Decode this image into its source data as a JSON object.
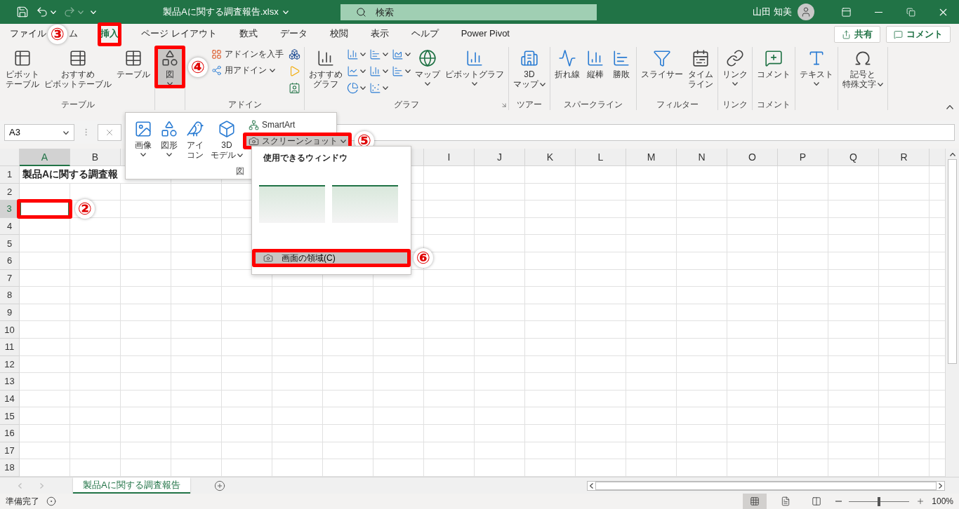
{
  "title_bar": {
    "file_name": "製品Aに関する調査報告.xlsx",
    "search_placeholder": "検索",
    "user_name": "山田 知美"
  },
  "tabs": [
    {
      "label": "ファイル",
      "selected": false
    },
    {
      "label": "ム",
      "selected": false
    },
    {
      "label": "挿入",
      "selected": true,
      "annotation": {
        "number": "③",
        "kind": "left"
      }
    },
    {
      "label": "ページ レイアウト",
      "selected": false
    },
    {
      "label": "数式",
      "selected": false
    },
    {
      "label": "データ",
      "selected": false
    },
    {
      "label": "校閲",
      "selected": false
    },
    {
      "label": "表示",
      "selected": false
    },
    {
      "label": "ヘルプ",
      "selected": false
    },
    {
      "label": "Power Pivot",
      "selected": false
    }
  ],
  "share_button": "共有",
  "comment_button": "コメント",
  "ribbon": {
    "groups": [
      {
        "label": "テーブル",
        "columns": [
          [
            {
              "kind": "large",
              "lines": [
                "ピボット",
                "テーブル"
              ]
            }
          ],
          [
            {
              "kind": "large",
              "lines": [
                "おすすめ",
                "ピボットテーブル"
              ]
            }
          ],
          [
            {
              "kind": "large",
              "lines": [
                "テーブル"
              ]
            }
          ]
        ]
      },
      {
        "columns": [
          [
            {
              "kind": "large",
              "lines": [
                "図"
              ],
              "caret_below": true,
              "pressed": true,
              "annotation": {
                "number": "④",
                "kind": "right"
              }
            }
          ]
        ]
      },
      {
        "label": "アドイン",
        "columns": [
          [
            {
              "kind": "small",
              "label": "アドインを入手"
            },
            {
              "kind": "small",
              "label": "用アドイン",
              "caret_inline": true
            }
          ],
          [
            {
              "kind": "icon"
            },
            {
              "kind": "icon"
            },
            {
              "kind": "icon"
            }
          ]
        ]
      },
      {
        "label": "グラフ",
        "launcher": true,
        "columns": [
          [
            {
              "kind": "large",
              "lines": [
                "おすすめ",
                "グラフ"
              ]
            }
          ],
          [
            {
              "kind": "icon",
              "caret_inline": true
            },
            {
              "kind": "icon",
              "caret_inline": true
            },
            {
              "kind": "icon",
              "caret_inline": true
            }
          ],
          [
            {
              "kind": "icon",
              "caret_inline": true
            },
            {
              "kind": "icon",
              "caret_inline": true
            },
            {
              "kind": "icon",
              "caret_inline": true
            }
          ],
          [
            {
              "kind": "icon",
              "caret_inline": true
            },
            {
              "kind": "icon",
              "caret_inline": true
            }
          ],
          [
            {
              "kind": "large",
              "lines": [
                "マップ"
              ],
              "caret_below": true
            }
          ],
          [
            {
              "kind": "large",
              "lines": [
                "ピボットグラフ"
              ],
              "caret_below": true
            }
          ]
        ]
      },
      {
        "label": "ツアー",
        "columns": [
          [
            {
              "kind": "large",
              "lines": [
                "3D",
                "マップ"
              ],
              "caret_inline": true
            }
          ]
        ]
      },
      {
        "label": "スパークライン",
        "columns": [
          [
            {
              "kind": "large",
              "lines": [
                "折れ線"
              ]
            }
          ],
          [
            {
              "kind": "large",
              "lines": [
                "縦棒"
              ]
            }
          ],
          [
            {
              "kind": "large",
              "lines": [
                "勝敗"
              ]
            }
          ]
        ]
      },
      {
        "label": "フィルター",
        "columns": [
          [
            {
              "kind": "large",
              "lines": [
                "スライサー"
              ]
            }
          ],
          [
            {
              "kind": "large",
              "lines": [
                "タイム",
                "ライン"
              ]
            }
          ]
        ]
      },
      {
        "label": "リンク",
        "columns": [
          [
            {
              "kind": "large",
              "lines": [
                "リンク"
              ],
              "caret_below": true
            }
          ]
        ]
      },
      {
        "label": "コメント",
        "columns": [
          [
            {
              "kind": "large",
              "lines": [
                "コメント"
              ]
            }
          ]
        ]
      },
      {
        "columns": [
          [
            {
              "kind": "large",
              "lines": [
                "テキスト"
              ],
              "caret_below": true
            }
          ]
        ]
      },
      {
        "columns": [
          [
            {
              "kind": "large",
              "lines": [
                "記号と",
                "特殊文字"
              ],
              "caret_inline": true
            }
          ]
        ]
      }
    ]
  },
  "formula_bar": {
    "name_box": "A3"
  },
  "columns": [
    {
      "label": "A",
      "selected": true
    },
    {
      "label": "B",
      "selected": false
    },
    {
      "selected": false
    },
    {},
    {},
    {},
    {},
    {
      "selected": false
    },
    {
      "label": "I",
      "selected": false
    },
    {
      "label": "J",
      "selected": false
    },
    {
      "label": "K",
      "selected": false
    },
    {
      "label": "L",
      "selected": false
    },
    {
      "label": "M",
      "selected": false
    },
    {
      "label": "N",
      "selected": false
    },
    {
      "label": "O",
      "selected": false
    },
    {
      "label": "P",
      "selected": false
    },
    {
      "label": "Q",
      "selected": false
    },
    {
      "label": "R",
      "selected": false
    }
  ],
  "rows": [
    {
      "header": "1",
      "selected": false,
      "cells": [
        {
          "text": "製品Aに関する調査報",
          "selected": false
        }
      ]
    },
    {
      "header": "2",
      "selected": false
    },
    {
      "header": "3",
      "selected": true,
      "cells": [
        {
          "selected": true,
          "annotation": {
            "number": "②",
            "kind": "right"
          }
        }
      ]
    },
    {
      "header": "4",
      "selected": false
    },
    {
      "header": "5",
      "selected": false
    },
    {
      "header": "6",
      "selected": false
    },
    {
      "header": "7",
      "selected": false
    },
    {
      "header": "8",
      "selected": false
    },
    {
      "header": "9",
      "selected": false
    },
    {
      "header": "10",
      "selected": false
    },
    {
      "header": "11",
      "selected": false
    },
    {
      "header": "12",
      "selected": false
    },
    {
      "header": "13",
      "selected": false
    },
    {
      "header": "14",
      "selected": false
    },
    {
      "header": "15",
      "selected": false
    },
    {
      "header": "16",
      "selected": false
    },
    {
      "header": "17",
      "selected": false
    },
    {
      "header": "18",
      "selected": false
    }
  ],
  "picture_menu": {
    "label": "図",
    "columns": [
      [
        {
          "kind": "large",
          "lines": [
            "画像"
          ],
          "caret_below": true
        }
      ],
      [
        {
          "kind": "large",
          "lines": [
            "図形"
          ],
          "caret_below": true
        }
      ],
      [
        {
          "kind": "large",
          "lines": [
            "アイ",
            "コン"
          ]
        }
      ],
      [
        {
          "kind": "large",
          "lines": [
            "3D",
            "モデル"
          ],
          "caret_inline": true
        }
      ],
      [
        {
          "kind": "small",
          "label": "SmartArt"
        },
        {
          "kind": "small",
          "label": "スクリーンショット",
          "caret_inline": true,
          "pressed": true,
          "annotation": {
            "number": "⑤",
            "kind": "right"
          }
        }
      ]
    ]
  },
  "screenshot_menu": {
    "heading": "使用できるウィンドウ",
    "items": [
      {
        "label": "画面の領域(C)",
        "selected": true,
        "annotation": {
          "number": "⑥",
          "kind": "right"
        }
      }
    ]
  },
  "sheets": [
    {
      "label": "製品Aに関する調査報告",
      "selected": true
    }
  ],
  "status_bar": {
    "status": "準備完了",
    "views": [
      {
        "kind": "normal",
        "selected": true
      },
      {
        "kind": "page-layout",
        "selected": false
      },
      {
        "kind": "page-break",
        "selected": false
      }
    ],
    "zoom": {
      "level": 0.5,
      "reading": "100%"
    }
  }
}
